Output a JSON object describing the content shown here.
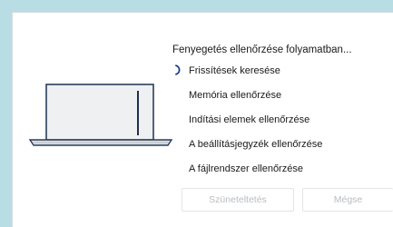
{
  "dialog": {
    "title": "Fenyegetés ellenőrzése folyamatban...",
    "steps": [
      {
        "label": "Frissítések keresése",
        "state": "in-progress"
      },
      {
        "label": "Memória ellenőrzése",
        "state": "pending"
      },
      {
        "label": "Indítási elemek ellenőrzése",
        "state": "pending"
      },
      {
        "label": "A beállításjegyzék ellenőrzése",
        "state": "pending"
      },
      {
        "label": "A fájlrendszer ellenőrzése",
        "state": "pending"
      }
    ],
    "buttons": {
      "pause": "Szüneteltetés",
      "cancel": "Mégse"
    }
  },
  "colors": {
    "background": "#b9dde5",
    "laptop_outline": "#2c3e5a",
    "spinner": "#1e3a8a",
    "disabled_text": "#b8bcc0"
  },
  "icons": {
    "illustration": "laptop-icon",
    "progress": "spinner-icon"
  }
}
